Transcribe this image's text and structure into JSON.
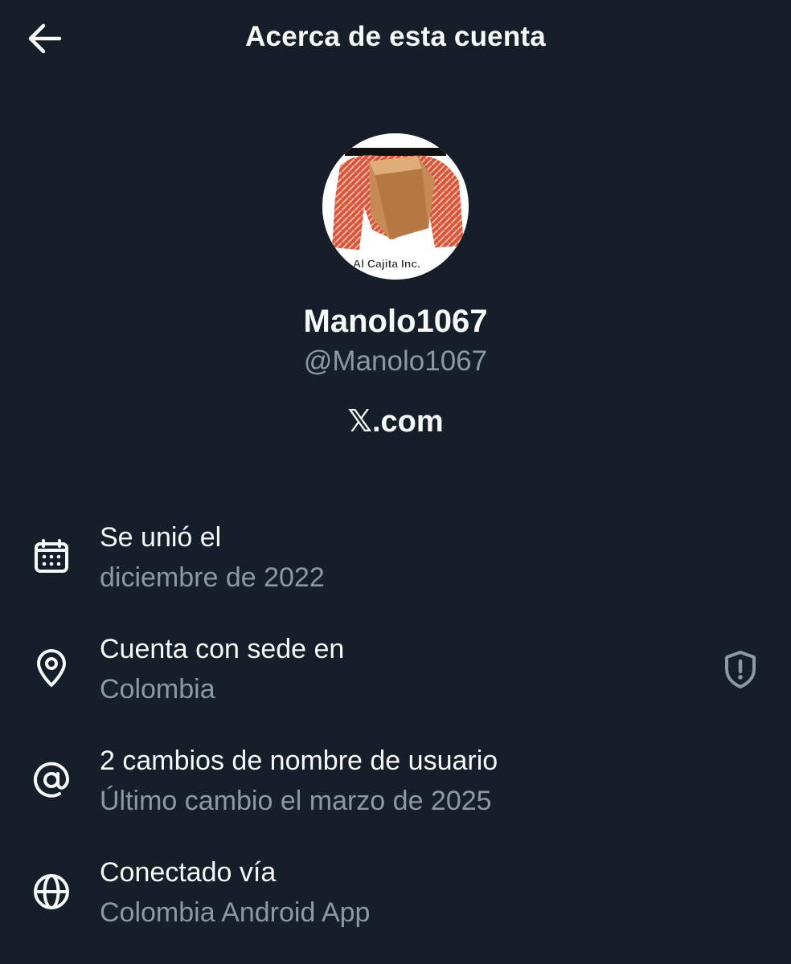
{
  "header": {
    "back_icon": "arrow-left-icon",
    "title": "Acerca de esta cuenta"
  },
  "profile": {
    "avatar_caption": "Al Cajita Inc.",
    "display_name": "Manolo1067",
    "handle": "@Manolo1067",
    "brand": "𝕏.com"
  },
  "rows": [
    {
      "icon": "calendar-icon",
      "title": "Se unió el",
      "value": "diciembre de 2022"
    },
    {
      "icon": "location-pin-icon",
      "title": "Cuenta con sede en",
      "value": "Colombia",
      "trailing_icon": "shield-alert-icon"
    },
    {
      "icon": "at-sign-icon",
      "title": "2 cambios de nombre de usuario",
      "value": "Último cambio el marzo de 2025"
    },
    {
      "icon": "globe-icon",
      "title": "Conectado vía",
      "value": "Colombia Android App"
    }
  ],
  "colors": {
    "background": "#161f29",
    "primary_text": "#f7f9f9",
    "secondary_text": "#8b98a5"
  }
}
